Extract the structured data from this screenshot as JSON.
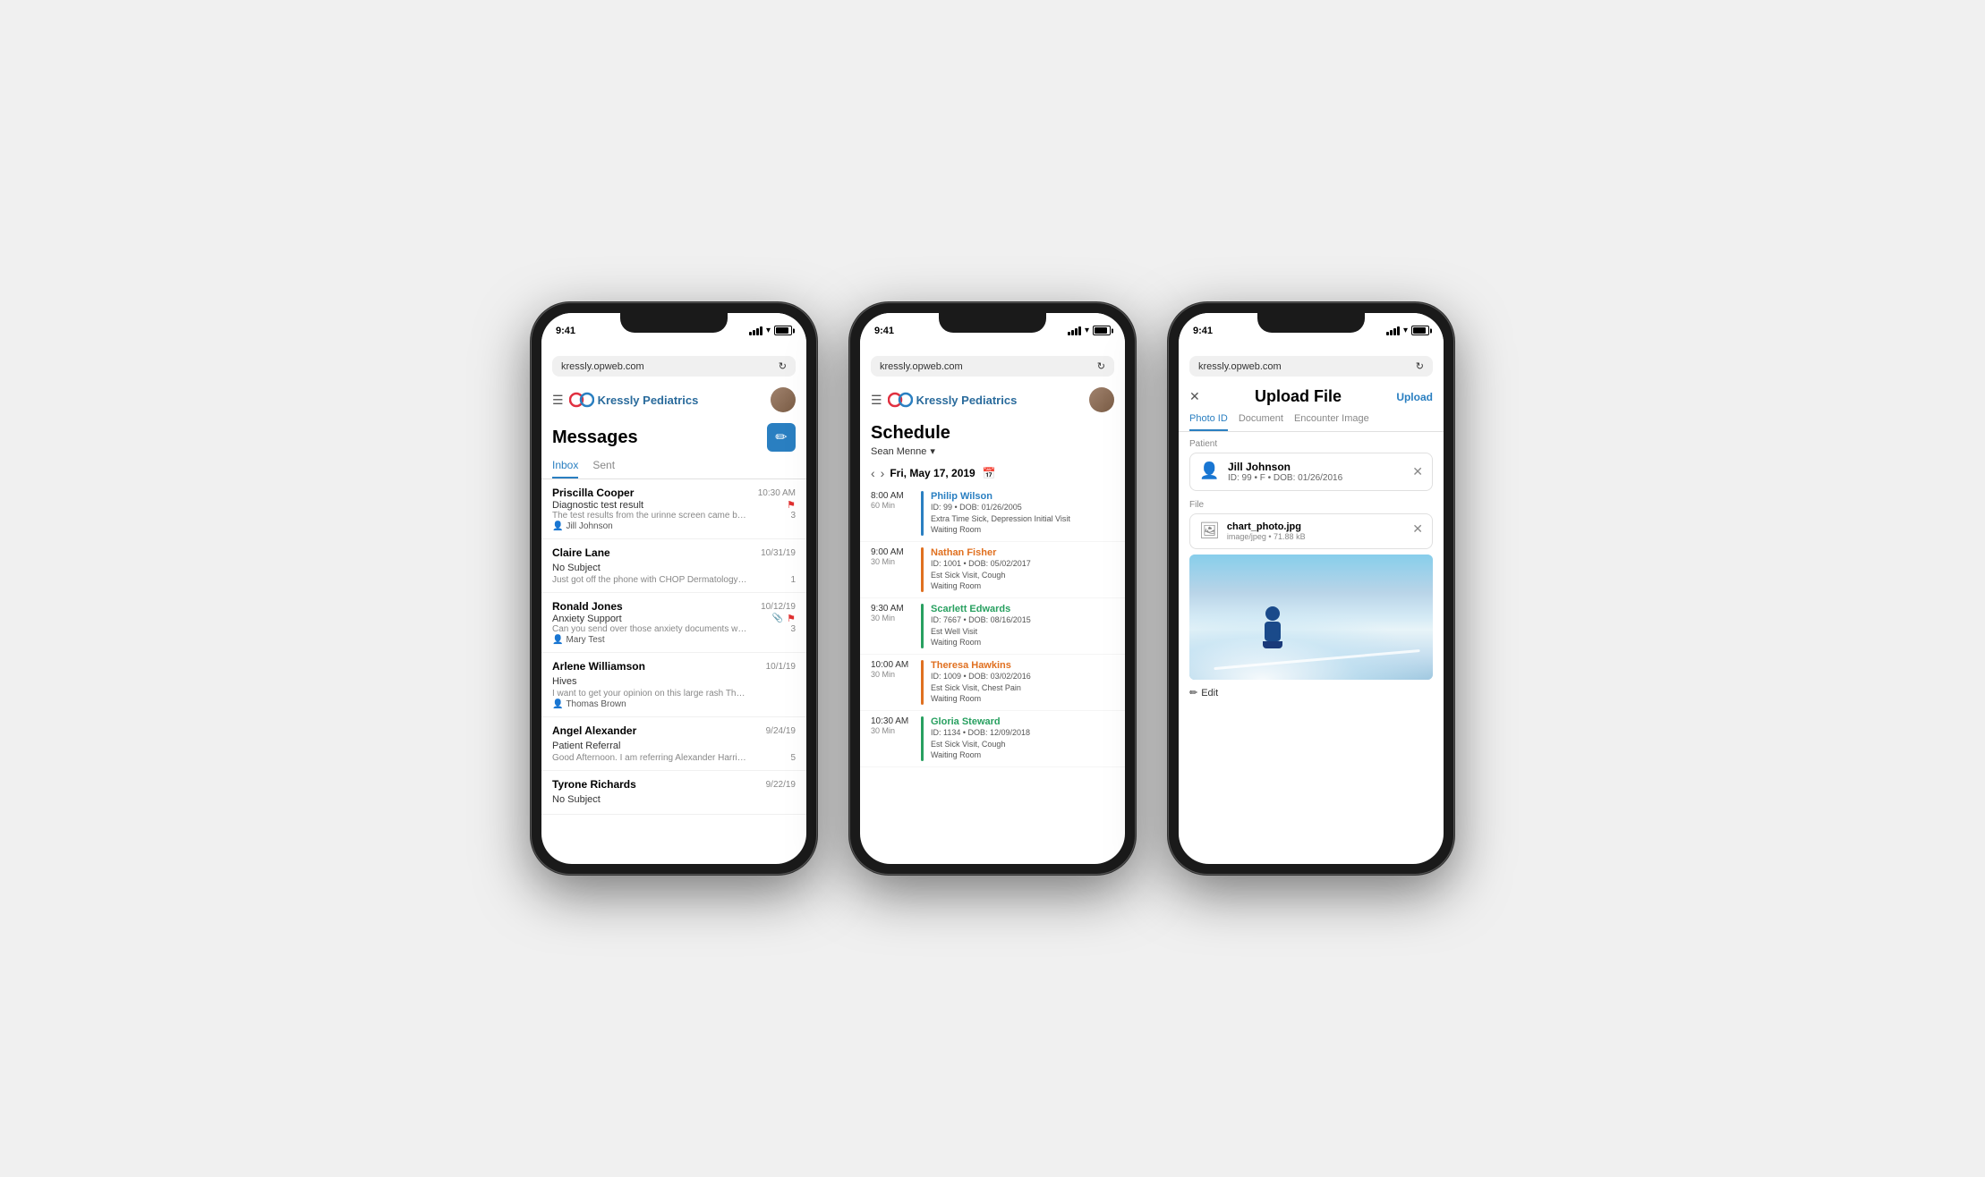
{
  "common": {
    "time": "9:41",
    "url": "kressly.opweb.com",
    "app_name": "Kressly Pediatrics"
  },
  "phone1": {
    "screen": "messages",
    "title": "Messages",
    "tabs": [
      "Inbox",
      "Sent"
    ],
    "active_tab": "Inbox",
    "compose_label": "✏",
    "messages": [
      {
        "sender": "Priscilla Cooper",
        "time": "10:30 AM",
        "subject": "Diagnostic test result",
        "preview": "The test results from the urinne screen came back...",
        "patient": "Jill Johnson",
        "count": "3",
        "flag": true,
        "clip": false
      },
      {
        "sender": "Claire Lane",
        "time": "10/31/19",
        "subject": "No Subject",
        "preview": "Just got off the phone with CHOP Dermatology and...",
        "patient": "",
        "count": "1",
        "flag": false,
        "clip": false
      },
      {
        "sender": "Ronald Jones",
        "time": "10/12/19",
        "subject": "Anxiety Support",
        "preview": "Can you send over those anxiety documents when...",
        "patient": "Mary Test",
        "count": "3",
        "flag": true,
        "clip": true
      },
      {
        "sender": "Arlene Williamson",
        "time": "10/1/19",
        "subject": "Hives",
        "preview": "I want to get your opinion on this large rash Thoma...",
        "patient": "Thomas Brown",
        "count": "",
        "flag": false,
        "clip": false
      },
      {
        "sender": "Angel Alexander",
        "time": "9/24/19",
        "subject": "Patient Referral",
        "preview": "Good Afternoon. I am referring Alexander Harris to...",
        "patient": "",
        "count": "5",
        "flag": false,
        "clip": false
      },
      {
        "sender": "Tyrone Richards",
        "time": "9/22/19",
        "subject": "No Subject",
        "preview": "",
        "patient": "",
        "count": "",
        "flag": false,
        "clip": false
      }
    ]
  },
  "phone2": {
    "screen": "schedule",
    "title": "Schedule",
    "user": "Sean Menne",
    "date": "Fri, May 17, 2019",
    "appointments": [
      {
        "time": "8:00 AM",
        "duration": "60 Min",
        "patient_name": "Philip Wilson",
        "details": "ID: 99  •  DOB: 01/26/2005\nExtra Time Sick, Depression Initial Visit\nWaiting Room",
        "color": "#2a7fc1"
      },
      {
        "time": "9:00 AM",
        "duration": "30 Min",
        "patient_name": "Nathan Fisher",
        "details": "ID: 1001  •  DOB: 05/02/2017\nEst Sick Visit, Cough\nWaiting Room",
        "color": "#e07020"
      },
      {
        "time": "9:30 AM",
        "duration": "30 Min",
        "patient_name": "Scarlett Edwards",
        "details": "ID: 7667  •  DOB: 08/16/2015\nEst Well Visit\nWaiting Room",
        "color": "#28a060"
      },
      {
        "time": "10:00 AM",
        "duration": "30 Min",
        "patient_name": "Theresa Hawkins",
        "details": "ID: 1009  •  DOB: 03/02/2016\nEst Sick Visit, Chest Pain\nWaiting Room",
        "color": "#e07020"
      },
      {
        "time": "10:30 AM",
        "duration": "30 Min",
        "patient_name": "Gloria Steward",
        "details": "ID: 1134  •  DOB: 12/09/2018\nEst Sick Visit, Cough\nWaiting Room",
        "color": "#28a060"
      }
    ]
  },
  "phone3": {
    "screen": "upload",
    "title": "Upload File",
    "action_label": "Upload",
    "tabs": [
      "Photo ID",
      "Document",
      "Encounter Image"
    ],
    "active_tab": "Photo ID",
    "patient_label": "Patient",
    "patient_name": "Jill Johnson",
    "patient_meta": "ID: 99  •  F  •  DOB: 01/26/2016",
    "file_label": "File",
    "file_name": "chart_photo.jpg",
    "file_meta": "image/jpeg  •  71.88 kB",
    "edit_label": "Edit"
  }
}
